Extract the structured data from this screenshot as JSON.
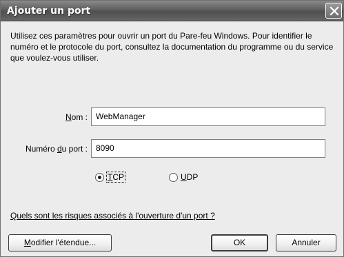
{
  "window": {
    "title": "Ajouter un port",
    "close_glyph": "✕"
  },
  "description": "Utilisez ces paramètres pour ouvrir un port du Pare-feu Windows. Pour identifier le numéro et le protocole du port, consultez la documentation du programme ou du service que voulez-vous utiliser.",
  "form": {
    "name_label_prefix": "",
    "name_label_mnemonic": "N",
    "name_label_rest": "om :",
    "name_value": "WebManager",
    "port_label_prefix": "Numéro ",
    "port_label_mnemonic": "d",
    "port_label_rest": "u port :",
    "port_value": "8090"
  },
  "protocol": {
    "tcp_mnemonic": "T",
    "tcp_rest": "CP",
    "udp_mnemonic": "U",
    "udp_rest": "DP",
    "selected": "TCP"
  },
  "risk_link": "Quels sont les risques associés à l'ouverture d'un port ?",
  "buttons": {
    "scope_mnemonic": "M",
    "scope_rest": "odifier l'étendue...",
    "ok_label": "OK",
    "cancel_label": "Annuler"
  }
}
